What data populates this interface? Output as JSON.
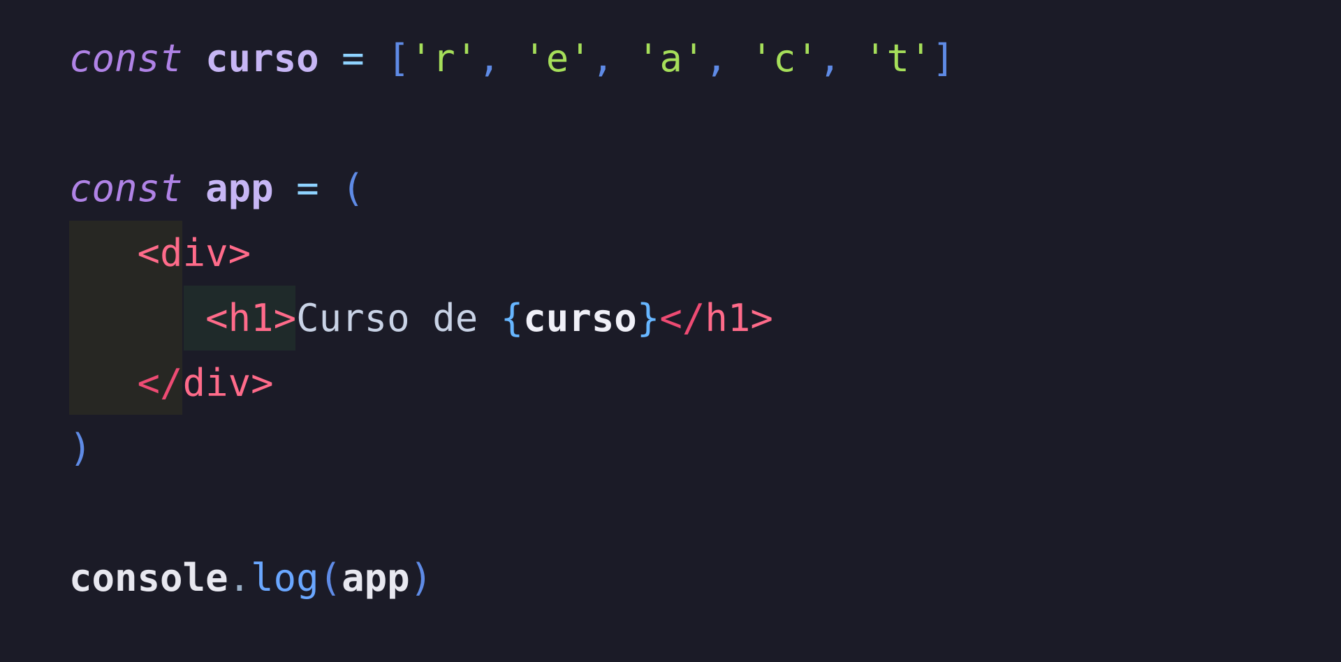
{
  "code": {
    "line1": {
      "kw": "const",
      "name": "curso",
      "op": "=",
      "open": "[",
      "items": [
        "'r'",
        "'e'",
        "'a'",
        "'c'",
        "'t'"
      ],
      "sep": ",",
      "close": "]"
    },
    "line3": {
      "kw": "const",
      "name": "app",
      "op": "=",
      "paren": "("
    },
    "line4": {
      "open_tag": "<div>"
    },
    "line5": {
      "h1_open": "<h1>",
      "text": "Curso de ",
      "lbrace": "{",
      "expr": "curso",
      "rbrace": "}",
      "h1_close_lt": "</",
      "h1_close_name": "h1>"
    },
    "line6": {
      "close_lt": "</",
      "close_name": "div>"
    },
    "line7": {
      "paren": ")"
    },
    "line9": {
      "obj": "console",
      "dot": ".",
      "method": "log",
      "lparen": "(",
      "arg": "app",
      "rparen": ")"
    }
  },
  "colors": {
    "background": "#1b1b27",
    "keyword": "#b083e6",
    "string": "#a6df5a",
    "tag": "#ee4b73",
    "bracket": "#5f8be6"
  }
}
